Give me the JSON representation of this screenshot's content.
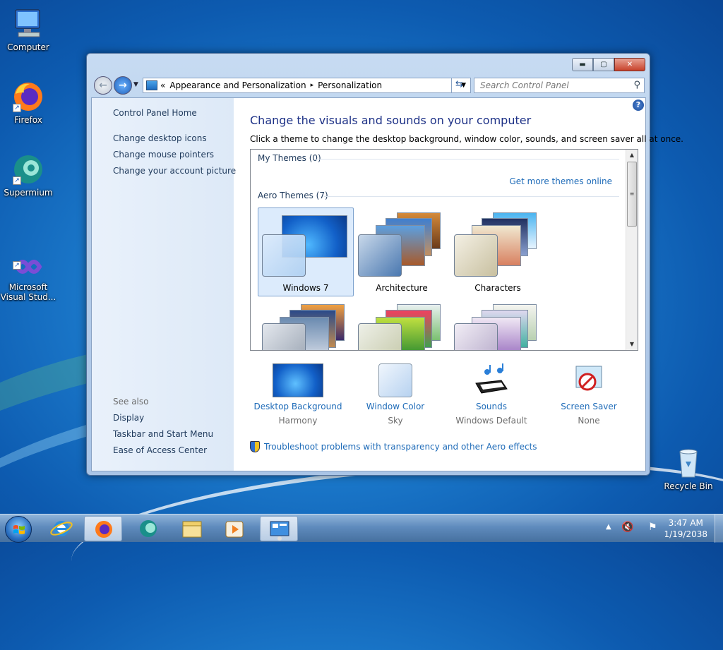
{
  "desktop": {
    "icons": [
      {
        "label": "Computer"
      },
      {
        "label": "Firefox"
      },
      {
        "label": "Supermium"
      },
      {
        "label": "Microsoft\nVisual Stud..."
      },
      {
        "label": "Recycle Bin"
      }
    ]
  },
  "window": {
    "caption_buttons": {
      "minimize": "▬",
      "maximize": "▢",
      "close": "✕"
    },
    "address": {
      "prefix": "«",
      "crumbs": [
        "Appearance and Personalization",
        "Personalization"
      ],
      "separator": "▸"
    },
    "search_placeholder": "Search Control Panel",
    "sidebar": {
      "home": "Control Panel Home",
      "links": [
        "Change desktop icons",
        "Change mouse pointers",
        "Change your account picture"
      ],
      "see_also_label": "See also",
      "see_also": [
        "Display",
        "Taskbar and Start Menu",
        "Ease of Access Center"
      ]
    },
    "main": {
      "title": "Change the visuals and sounds on your computer",
      "description": "Click a theme to change the desktop background, window color, sounds, and screen saver all at once.",
      "my_themes_label": "My Themes (0)",
      "get_more_link": "Get more themes online",
      "aero_themes_label": "Aero Themes (7)",
      "themes": [
        {
          "name": "Windows 7",
          "selected": true
        },
        {
          "name": "Architecture",
          "selected": false
        },
        {
          "name": "Characters",
          "selected": false
        }
      ],
      "settings": [
        {
          "title": "Desktop Background",
          "value": "Harmony"
        },
        {
          "title": "Window Color",
          "value": "Sky"
        },
        {
          "title": "Sounds",
          "value": "Windows Default"
        },
        {
          "title": "Screen Saver",
          "value": "None"
        }
      ],
      "troubleshoot_link": "Troubleshoot problems with transparency and other Aero effects"
    }
  },
  "taskbar": {
    "clock_time": "3:47 AM",
    "clock_date": "1/19/2038"
  },
  "colors": {
    "link": "#1e6bb8",
    "heading": "#1e3287",
    "selection": "#dcebfc"
  }
}
